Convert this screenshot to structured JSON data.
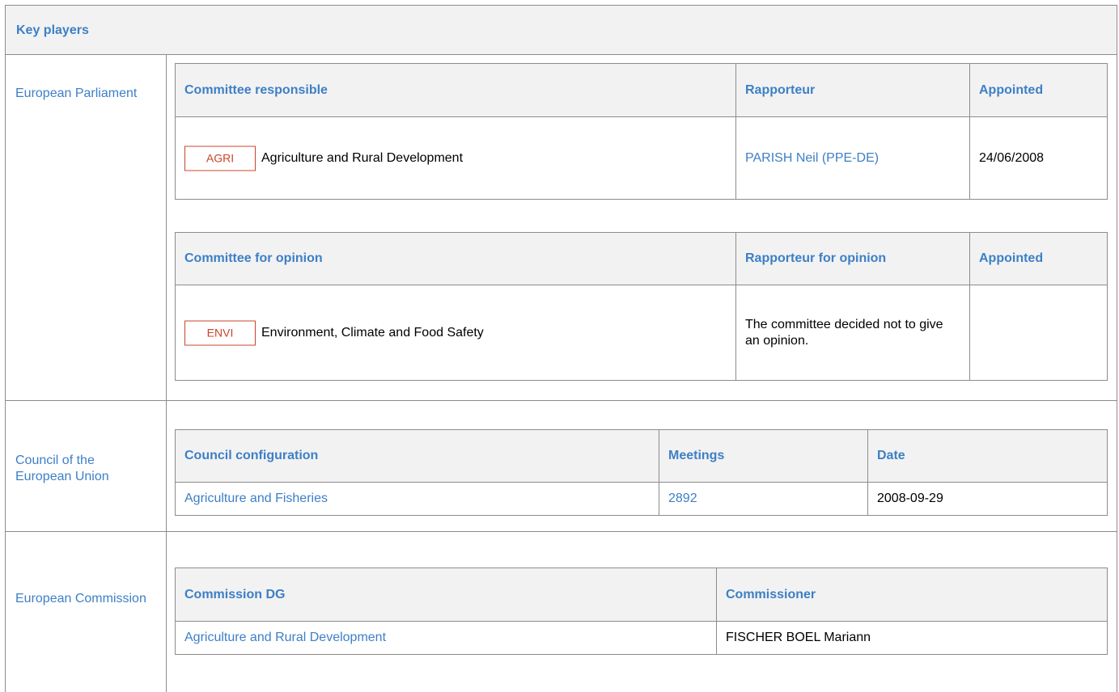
{
  "title": "Key players",
  "parliament": {
    "label": "European Parliament",
    "responsible_table": {
      "headers": [
        "Committee responsible",
        "Rapporteur",
        "Appointed"
      ],
      "row": {
        "badge": "AGRI",
        "committee": "Agriculture and Rural Development",
        "rapporteur": "PARISH Neil (PPE-DE)",
        "appointed": "24/06/2008"
      }
    },
    "opinion_table": {
      "headers": [
        "Committee for opinion",
        "Rapporteur for opinion",
        "Appointed"
      ],
      "row": {
        "badge": "ENVI",
        "committee": "Environment, Climate and Food Safety",
        "rapporteur": "The committee decided not to give an opinion.",
        "appointed": ""
      }
    }
  },
  "council": {
    "label": "Council of the European Union",
    "headers": [
      "Council configuration",
      "Meetings",
      "Date"
    ],
    "row": {
      "configuration": "Agriculture and Fisheries",
      "meetings": "2892",
      "date": "2008-09-29"
    }
  },
  "commission": {
    "label": "European Commission",
    "headers": [
      "Commission DG",
      "Commissioner"
    ],
    "row": {
      "dg": "Agriculture and Rural Development",
      "commissioner": "FISCHER BOEL Mariann"
    }
  },
  "colors": {
    "link": "#3d7fc6",
    "badge": "#c8442b",
    "header_bg": "#f2f2f2",
    "border": "#8c8c8c"
  }
}
